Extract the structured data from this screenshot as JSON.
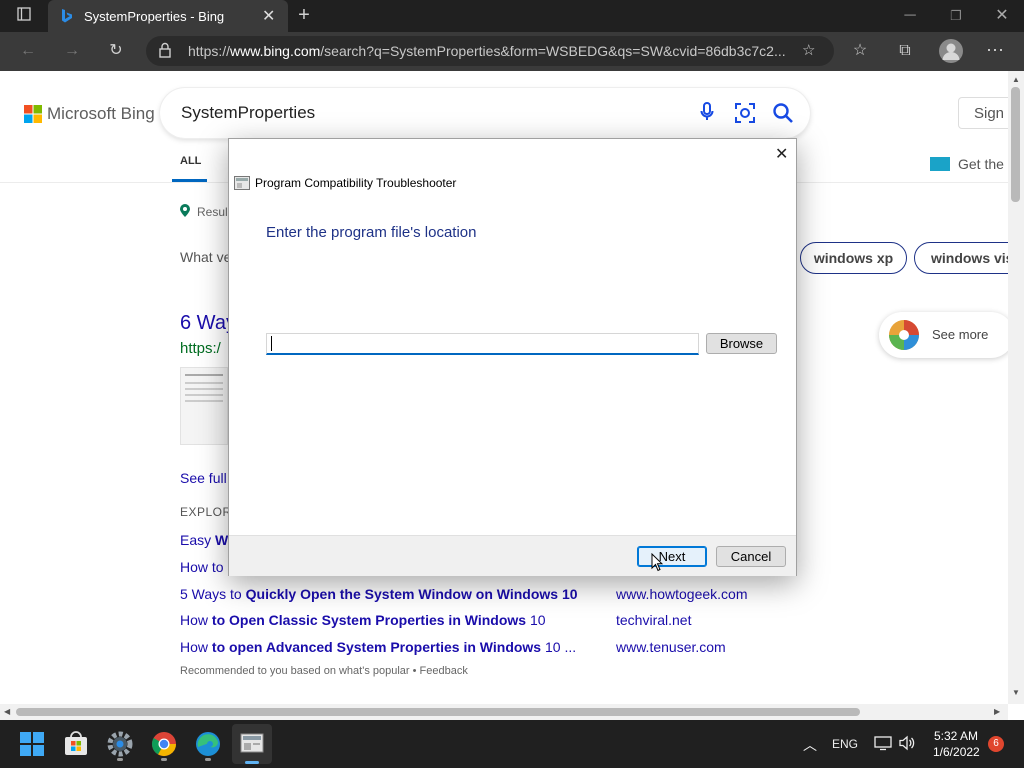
{
  "browser": {
    "tab_title": "SystemProperties - Bing",
    "url_prefix": "https://",
    "url_host": "www.bing.com",
    "url_rest": "/search?q=SystemProperties&form=WSBEDG&qs=SW&cvid=86db3c7c2..."
  },
  "bing": {
    "logo_text": "Microsoft Bing",
    "query": "SystemProperties",
    "sign_in": "Sign i",
    "tab_all": "ALL",
    "get_the": "Get the",
    "results_label": "Resul",
    "what_ve": "What ve",
    "chips": [
      "windows xp",
      "windows vis"
    ],
    "result_title": "6 Way",
    "result_url": "https:/",
    "see_full": "See full",
    "explore": "EXPLOR",
    "easy_prefix": "Easy ",
    "easy_bold": "Wa",
    "howto_prefix": "How to",
    "see_more": "See more",
    "links": [
      {
        "pre": "5 Ways to ",
        "bold": "Quickly Open the System Window on Windows 10",
        "post": "",
        "site": "www.howtogeek.com"
      },
      {
        "pre": "How ",
        "bold": "to Open Classic System Properties in Windows",
        "post": " 10",
        "site": "techviral.net"
      },
      {
        "pre": "How ",
        "bold": "to open Advanced System Properties in Windows",
        "post": " 10 ...",
        "site": "www.tenuser.com"
      }
    ],
    "recommended": "Recommended to you based on what's popular • Feedback"
  },
  "dialog": {
    "title": "Program Compatibility Troubleshooter",
    "heading": "Enter the program file's location",
    "input_value": "",
    "browse": "Browse",
    "next": "Next",
    "cancel": "Cancel"
  },
  "taskbar": {
    "lang": "ENG",
    "time": "5:32 AM",
    "date": "1/6/2022",
    "notif_count": "6"
  },
  "colors": {
    "accent": "#0067c0",
    "dialog_heading": "#1e3287",
    "bing_link": "#1a0dab",
    "green_url": "#006d21",
    "notif_badge": "#e0462e"
  }
}
